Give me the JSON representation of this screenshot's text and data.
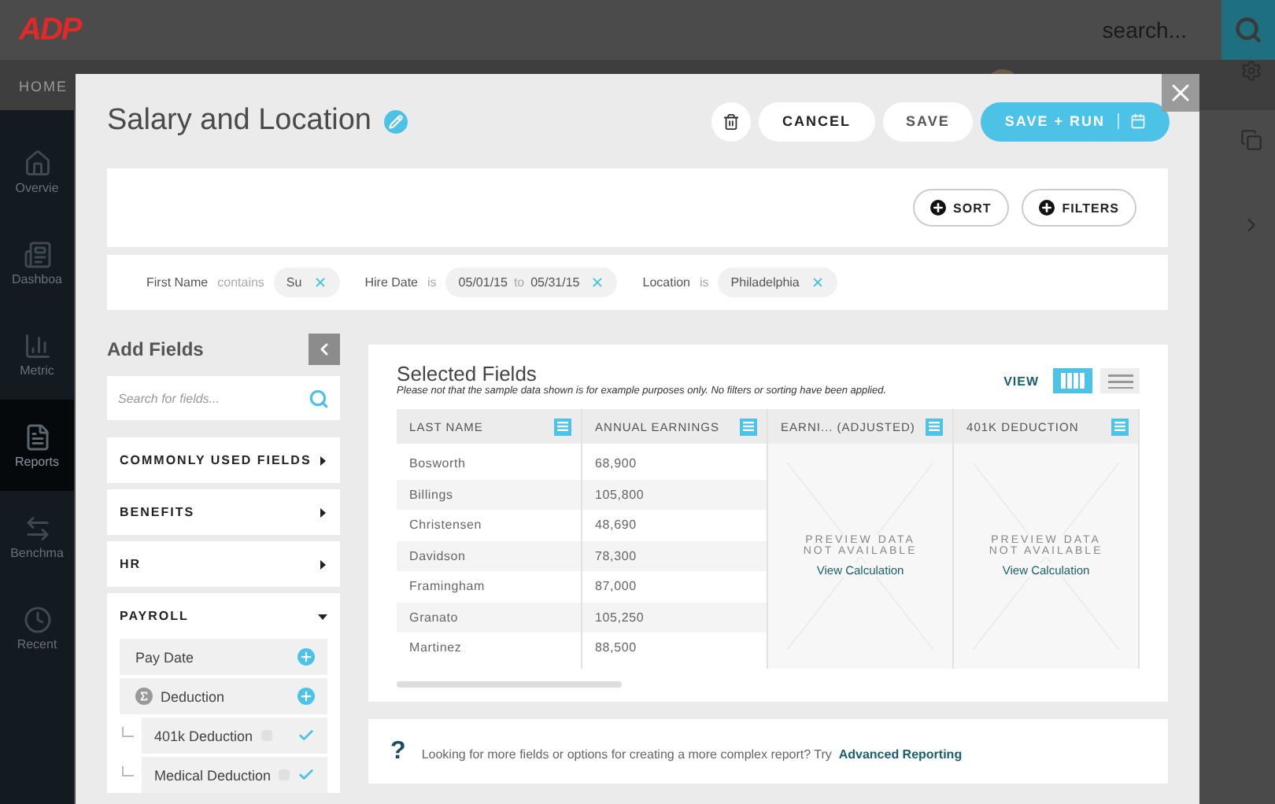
{
  "background": {
    "logo": "ADP",
    "search_placeholder": "search...",
    "nav": [
      "HOME"
    ],
    "sidebar": [
      {
        "label": "Overvie",
        "selected": false
      },
      {
        "label": "Dashboa",
        "selected": false
      },
      {
        "label": "Metric",
        "selected": false
      },
      {
        "label": "Reports",
        "selected": true
      },
      {
        "label": "Benchma",
        "selected": false
      },
      {
        "label": "Recent",
        "selected": false
      }
    ]
  },
  "modal": {
    "title": "Salary and Location",
    "actions": [
      {
        "kind": "delete"
      },
      {
        "kind": "plain",
        "label": "CANCEL",
        "strong": true
      },
      {
        "kind": "plain",
        "label": "SAVE",
        "strong": false
      },
      {
        "kind": "primary",
        "label": "SAVE + RUN"
      }
    ],
    "tools": [
      "SORT",
      "FILTERS"
    ],
    "filters": [
      {
        "field": "First Name",
        "operator": "contains",
        "values": [
          "Su"
        ]
      },
      {
        "field": "Hire Date",
        "operator": "is",
        "values": [
          "05/01/15",
          "05/31/15"
        ],
        "joiner": "to"
      },
      {
        "field": "Location",
        "operator": "is",
        "values": [
          "Philadelphia"
        ]
      }
    ],
    "add_fields": {
      "title": "Add Fields",
      "search_placeholder": "Search for fields...",
      "categories": [
        {
          "label": "COMMONLY USED FIELDS",
          "expanded": false
        },
        {
          "label": "BENEFITS",
          "expanded": false
        },
        {
          "label": "HR",
          "expanded": false
        },
        {
          "label": "PAYROLL",
          "expanded": true,
          "children": [
            {
              "label": "Pay Date",
              "kind": "field",
              "selected": false
            },
            {
              "label": "Deduction",
              "kind": "sum",
              "selected": false,
              "children": [
                {
                  "label": "401k Deduction",
                  "selected": true
                },
                {
                  "label": "Medical Deduction",
                  "selected": true
                }
              ]
            }
          ]
        }
      ]
    },
    "selected_fields": {
      "title": "Selected Fields",
      "note": "Please not that the sample data shown is for example purposes only. No filters or sorting have been applied.",
      "view_label": "VIEW",
      "views": [
        {
          "kind": "columns",
          "selected": true
        },
        {
          "kind": "rows",
          "selected": false
        }
      ],
      "columns": [
        {
          "label": "LAST NAME",
          "kind": "data",
          "values": [
            "Bosworth",
            "Billings",
            "Christensen",
            "Davidson",
            "Framingham",
            "Granato",
            "Martinez"
          ]
        },
        {
          "label": "ANNUAL EARNINGS",
          "kind": "data",
          "values": [
            "68,900",
            "105,800",
            "48,690",
            "78,300",
            "87,000",
            "105,250",
            "88,500"
          ]
        },
        {
          "label": "EARNI... (ADJUSTED)",
          "kind": "preview",
          "message": "PREVIEW DATA NOT AVAILABLE",
          "link": "View Calculation"
        },
        {
          "label": "401K DEDUCTION",
          "kind": "preview",
          "message": "PREVIEW DATA NOT AVAILABLE",
          "link": "View Calculation"
        }
      ]
    },
    "help": {
      "mark": "?",
      "text": "Looking for more fields or options for creating a more complex report? Try",
      "link": "Advanced Reporting"
    }
  }
}
